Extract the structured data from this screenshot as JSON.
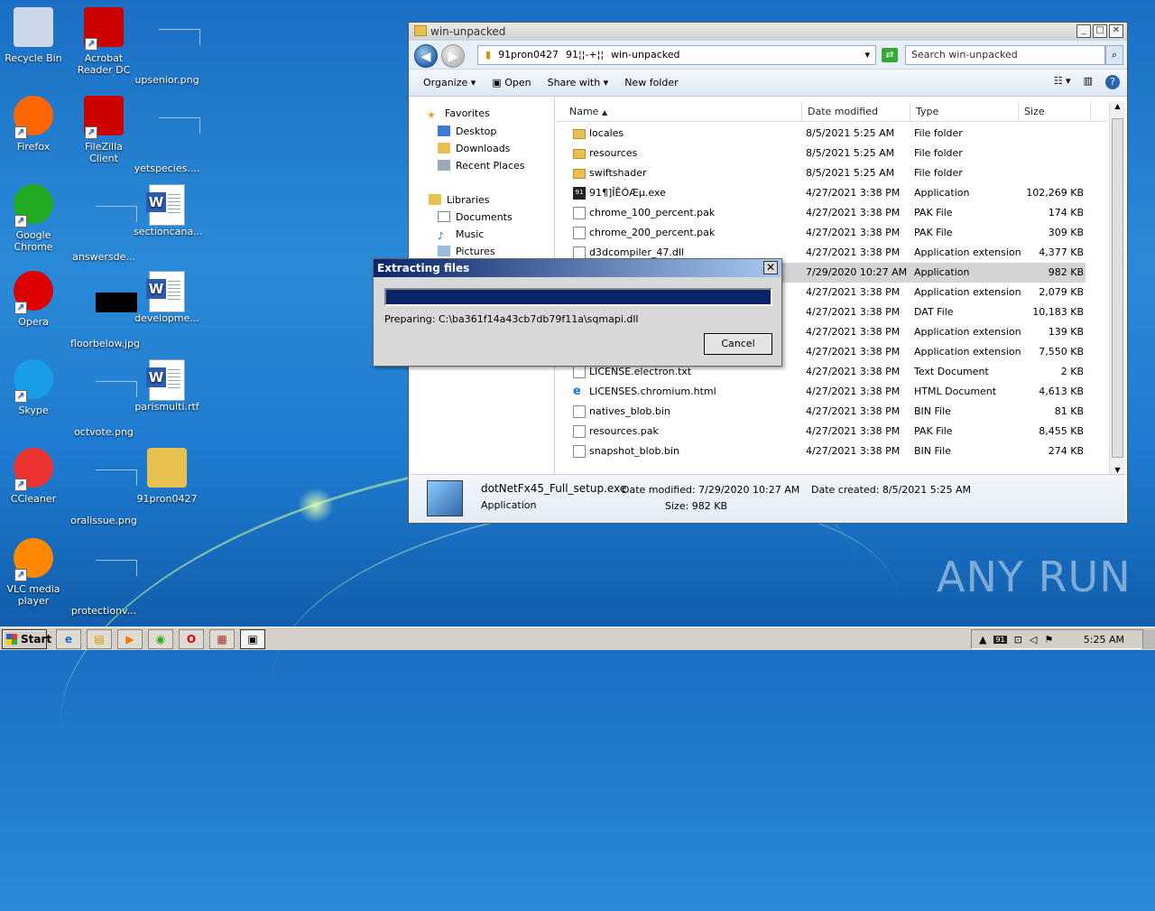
{
  "desktop": {
    "icons": [
      {
        "label": "Recycle Bin",
        "icon": "recycle-bin-icon"
      },
      {
        "label": "Acrobat Reader DC",
        "icon": "acrobat-icon"
      },
      {
        "label": "upsenior.png",
        "icon": "image-file-icon"
      },
      {
        "label": "Firefox",
        "icon": "firefox-icon"
      },
      {
        "label": "FileZilla Client",
        "icon": "filezilla-icon"
      },
      {
        "label": "yetspecies....",
        "icon": "file-icon"
      },
      {
        "label": "Google Chrome",
        "icon": "chrome-icon"
      },
      {
        "label": "answersde...",
        "icon": "file-icon"
      },
      {
        "label": "sectioncana...",
        "icon": "word-doc-icon"
      },
      {
        "label": "Opera",
        "icon": "opera-icon"
      },
      {
        "label": "floorbelow.jpg",
        "icon": "image-file-icon"
      },
      {
        "label": "developme...",
        "icon": "word-doc-icon"
      },
      {
        "label": "Skype",
        "icon": "skype-icon"
      },
      {
        "label": "octvote.png",
        "icon": "image-file-icon"
      },
      {
        "label": "parismulti.rtf",
        "icon": "word-doc-icon"
      },
      {
        "label": "CCleaner",
        "icon": "ccleaner-icon"
      },
      {
        "label": "oralissue.png",
        "icon": "image-file-icon"
      },
      {
        "label": "91pron0427",
        "icon": "folder-icon"
      },
      {
        "label": "VLC media player",
        "icon": "vlc-icon"
      },
      {
        "label": "protectionv...",
        "icon": "file-icon"
      }
    ]
  },
  "explorer": {
    "title": "win-unpacked",
    "path": [
      "91pron0427",
      "91¦¦-+¦¦",
      "win-unpacked"
    ],
    "search_placeholder": "Search win-unpacked",
    "toolbar": {
      "organize": "Organize",
      "open": "Open",
      "share": "Share with",
      "new_folder": "New folder"
    },
    "nav": {
      "favorites": "Favorites",
      "desktop": "Desktop",
      "downloads": "Downloads",
      "recent": "Recent Places",
      "libraries": "Libraries",
      "documents": "Documents",
      "music": "Music",
      "pictures": "Pictures"
    },
    "columns": {
      "name": "Name",
      "date": "Date modified",
      "type": "Type",
      "size": "Size"
    },
    "rows": [
      {
        "name": "locales",
        "date": "8/5/2021 5:25 AM",
        "type": "File folder",
        "size": "",
        "kind": "folder"
      },
      {
        "name": "resources",
        "date": "8/5/2021 5:25 AM",
        "type": "File folder",
        "size": "",
        "kind": "folder"
      },
      {
        "name": "swiftshader",
        "date": "8/5/2021 5:25 AM",
        "type": "File folder",
        "size": "",
        "kind": "folder"
      },
      {
        "name": "91¶]ÎÊÓÆµ.exe",
        "date": "4/27/2021 3:38 PM",
        "type": "Application",
        "size": "102,269 KB",
        "kind": "exe"
      },
      {
        "name": "chrome_100_percent.pak",
        "date": "4/27/2021 3:38 PM",
        "type": "PAK File",
        "size": "174 KB",
        "kind": "file"
      },
      {
        "name": "chrome_200_percent.pak",
        "date": "4/27/2021 3:38 PM",
        "type": "PAK File",
        "size": "309 KB",
        "kind": "file"
      },
      {
        "name": "d3dcompiler_47.dll",
        "date": "4/27/2021 3:38 PM",
        "type": "Application extension",
        "size": "4,377 KB",
        "kind": "file"
      },
      {
        "name": "",
        "date": "7/29/2020 10:27 AM",
        "type": "Application",
        "size": "982 KB",
        "kind": "none",
        "selected": true
      },
      {
        "name": "",
        "date": "4/27/2021 3:38 PM",
        "type": "Application extension",
        "size": "2,079 KB",
        "kind": "none"
      },
      {
        "name": "",
        "date": "4/27/2021 3:38 PM",
        "type": "DAT File",
        "size": "10,183 KB",
        "kind": "none"
      },
      {
        "name": "",
        "date": "4/27/2021 3:38 PM",
        "type": "Application extension",
        "size": "139 KB",
        "kind": "none"
      },
      {
        "name": "",
        "date": "4/27/2021 3:38 PM",
        "type": "Application extension",
        "size": "7,550 KB",
        "kind": "none"
      },
      {
        "name": "LICENSE.electron.txt",
        "date": "4/27/2021 3:38 PM",
        "type": "Text Document",
        "size": "2 KB",
        "kind": "file"
      },
      {
        "name": "LICENSES.chromium.html",
        "date": "4/27/2021 3:38 PM",
        "type": "HTML Document",
        "size": "4,613 KB",
        "kind": "ie"
      },
      {
        "name": "natives_blob.bin",
        "date": "4/27/2021 3:38 PM",
        "type": "BIN File",
        "size": "81 KB",
        "kind": "file"
      },
      {
        "name": "resources.pak",
        "date": "4/27/2021 3:38 PM",
        "type": "PAK File",
        "size": "8,455 KB",
        "kind": "file"
      },
      {
        "name": "snapshot_blob.bin",
        "date": "4/27/2021 3:38 PM",
        "type": "BIN File",
        "size": "274 KB",
        "kind": "file"
      }
    ],
    "details": {
      "filename": "dotNetFx45_Full_setup.exe",
      "date_modified": "Date modified: 7/29/2020 10:27 AM",
      "date_created": "Date created: 8/5/2021 5:25 AM",
      "type": "Application",
      "size": "Size: 982 KB"
    }
  },
  "dialog": {
    "title": "Extracting files",
    "progress": 1.0,
    "preparing": "Preparing: C:\\ba361f14a43cb7db79f11a\\sqmapi.dll",
    "cancel": "Cancel",
    "close": "✕"
  },
  "taskbar": {
    "start": "Start",
    "clock": "5:25 AM"
  },
  "watermark": "ANY RUN"
}
